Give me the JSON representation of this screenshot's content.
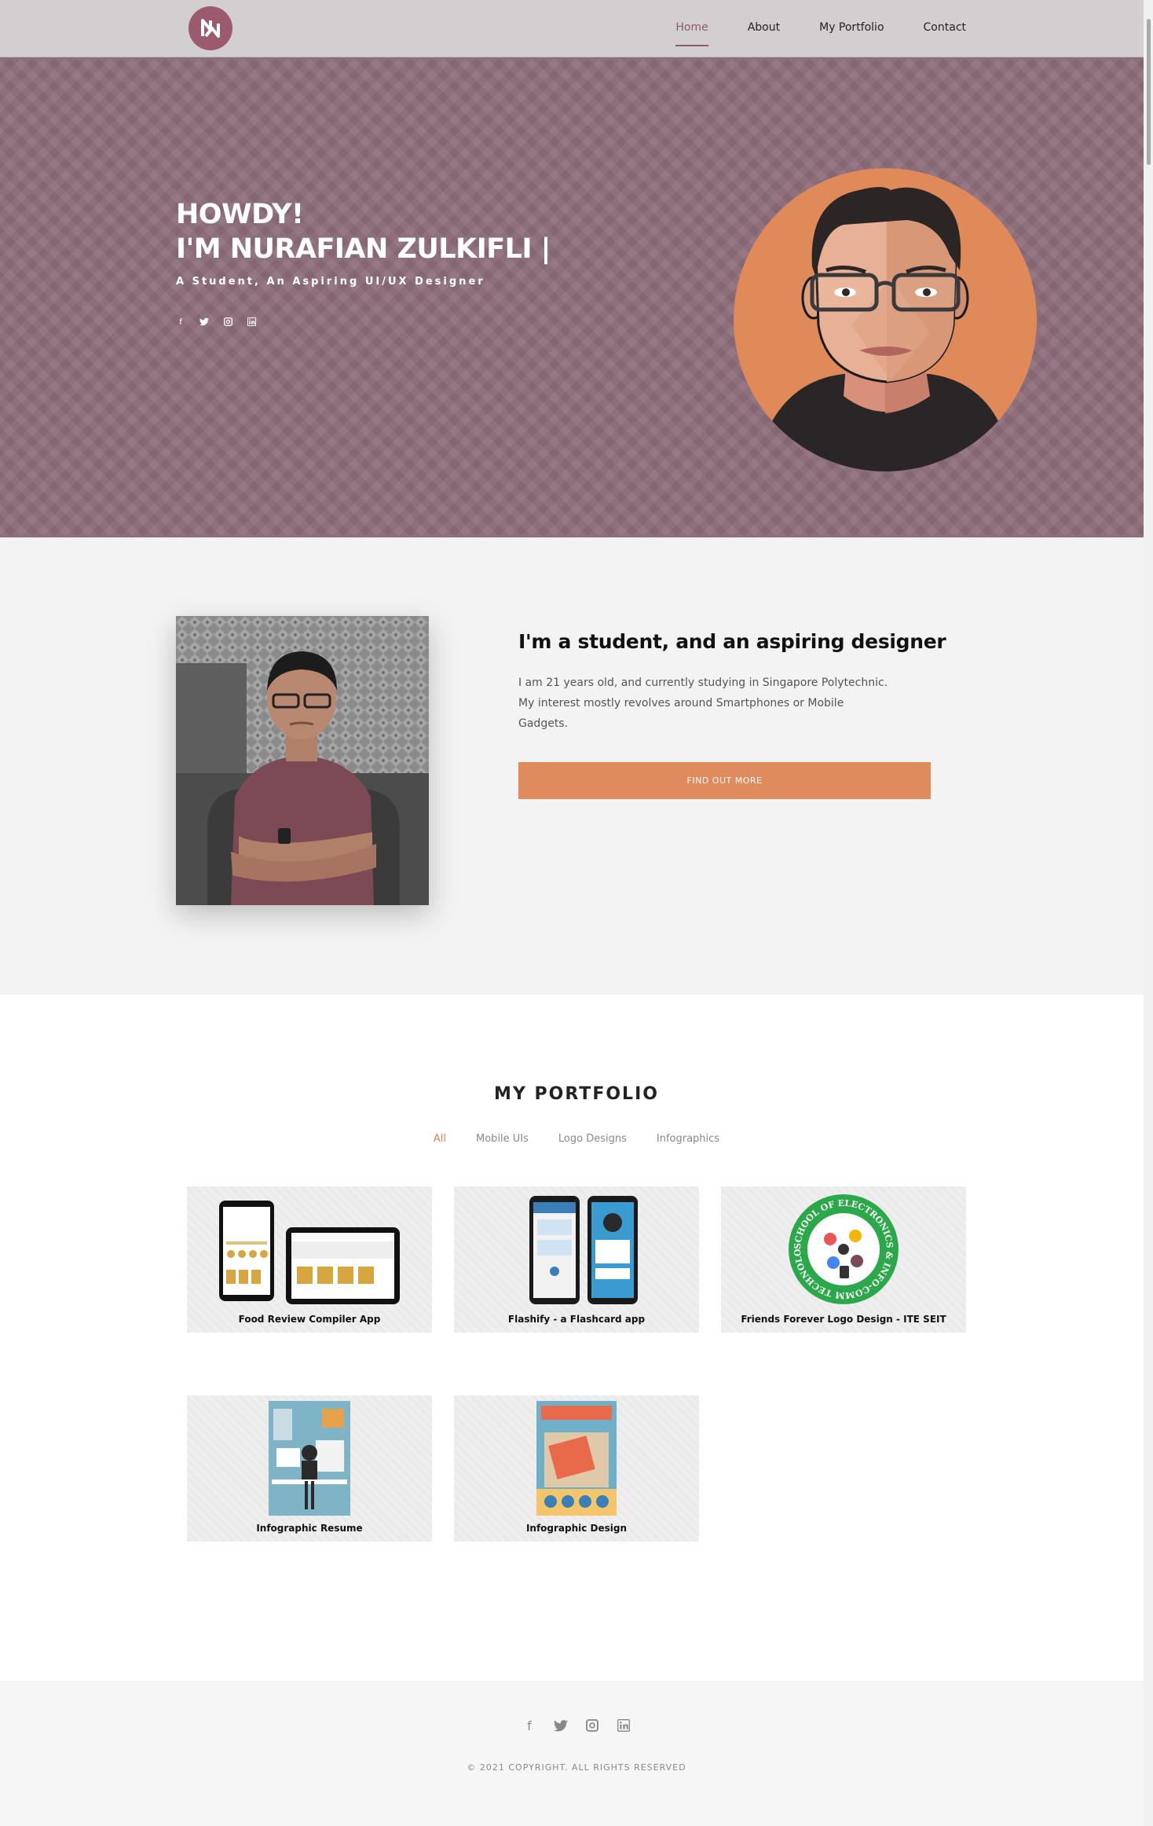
{
  "nav": {
    "links": [
      "Home",
      "About",
      "My Portfolio",
      "Contact"
    ],
    "active_index": 0
  },
  "hero": {
    "greeting": "HOWDY!",
    "name_line": "I'M NURAFIAN ZULKIFLI |",
    "subtitle": "A Student, An Aspiring UI/UX Designer",
    "social_icons": [
      "facebook-icon",
      "twitter-icon",
      "instagram-icon",
      "linkedin-icon"
    ]
  },
  "about": {
    "title": "I'm a student, and an aspiring designer",
    "text_line1": "I am 21 years old, and currently studying in Singapore Polytechnic.",
    "text_line2": "My interest mostly revolves around Smartphones or Mobile",
    "text_line3": "Gadgets.",
    "button_label": "FIND OUT MORE"
  },
  "portfolio": {
    "title": "MY PORTFOLIO",
    "filters": [
      "All",
      "Mobile UIs",
      "Logo Designs",
      "Infographics"
    ],
    "active_filter": "All",
    "items": [
      {
        "caption": "Food Review Compiler App"
      },
      {
        "caption": "Flashify - a Flashcard app"
      },
      {
        "caption": "Friends Forever Logo Design - ITE SEIT"
      },
      {
        "caption": "Infographic Resume"
      },
      {
        "caption": "Infographic Design"
      }
    ],
    "logo_ring_text": "SCHOOL OF ELECTRONICS & INFO-COMM TECHNOLOGY"
  },
  "footer": {
    "social_icons": [
      "facebook-icon",
      "twitter-icon",
      "instagram-icon",
      "linkedin-icon"
    ],
    "copyright": "© 2021 COPYRIGHT. ALL RIGHTS RESERVED"
  },
  "colors": {
    "hero_bg": "#8e6e7c",
    "accent": "#e08b5d",
    "brand": "#9c5a6f"
  }
}
